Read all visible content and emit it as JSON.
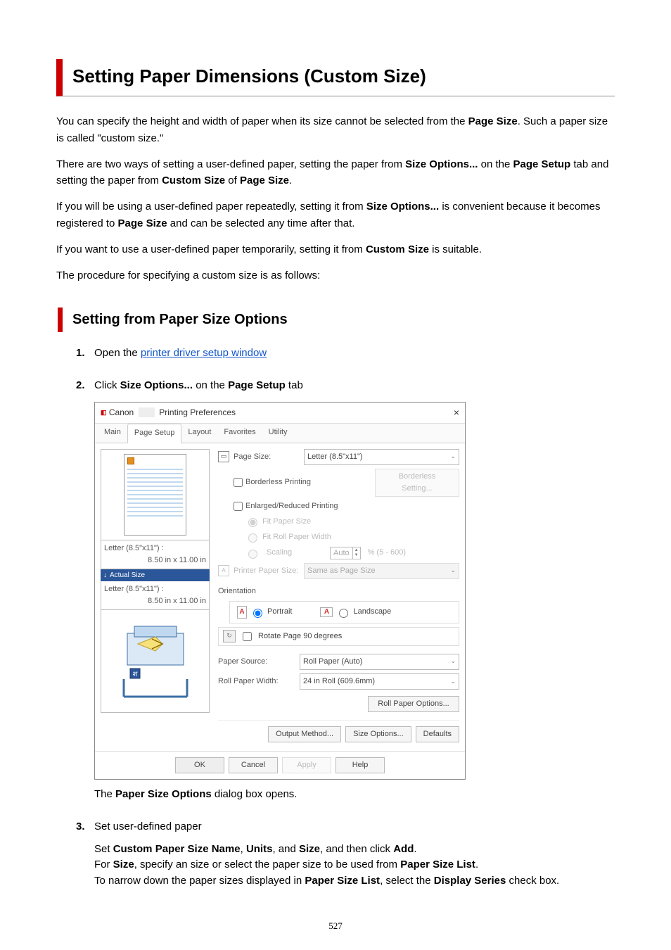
{
  "page": {
    "title": "Setting Paper Dimensions (Custom Size)",
    "intro1_a": "You can specify the height and width of paper when its size cannot be selected from the ",
    "intro1_b": "Page Size",
    "intro1_c": ". Such a paper size is called \"custom size.\"",
    "intro2_a": "There are two ways of setting a user-defined paper, setting the paper from ",
    "intro2_b": "Size Options...",
    "intro2_c": " on the ",
    "intro2_d": "Page Setup",
    "intro2_e": " tab and setting the paper from ",
    "intro2_f": "Custom Size",
    "intro2_g": " of ",
    "intro2_h": "Page Size",
    "intro2_i": ".",
    "intro3_a": "If you will be using a user-defined paper repeatedly, setting it from ",
    "intro3_b": "Size Options...",
    "intro3_c": " is convenient because it becomes registered to ",
    "intro3_d": "Page Size",
    "intro3_e": " and can be selected any time after that.",
    "intro4_a": "If you want to use a user-defined paper temporarily, setting it from ",
    "intro4_b": "Custom Size",
    "intro4_c": " is suitable.",
    "intro5": "The procedure for specifying a custom size is as follows:",
    "h2": "Setting from Paper Size Options",
    "page_number": "527"
  },
  "steps": {
    "s1_num": "1.",
    "s1_a": "Open the ",
    "s1_link": "printer driver setup window",
    "s2_num": "2.",
    "s2_a": "Click ",
    "s2_b": "Size Options...",
    "s2_c": " on the ",
    "s2_d": "Page Setup",
    "s2_e": " tab",
    "s2_body_a": "The ",
    "s2_body_b": "Paper Size Options",
    "s2_body_c": " dialog box opens.",
    "s3_num": "3.",
    "s3_title": "Set user-defined paper",
    "s3_l1_a": "Set ",
    "s3_l1_b": "Custom Paper Size Name",
    "s3_l1_c": ", ",
    "s3_l1_d": "Units",
    "s3_l1_e": ", and ",
    "s3_l1_f": "Size",
    "s3_l1_g": ", and then click ",
    "s3_l1_h": "Add",
    "s3_l1_i": ".",
    "s3_l2_a": "For ",
    "s3_l2_b": "Size",
    "s3_l2_c": ", specify an size or select the paper size to be used from ",
    "s3_l2_d": "Paper Size List",
    "s3_l2_e": ".",
    "s3_l3_a": "To narrow down the paper sizes displayed in ",
    "s3_l3_b": "Paper Size List",
    "s3_l3_c": ", select the ",
    "s3_l3_d": "Display Series",
    "s3_l3_e": " check box."
  },
  "dialog": {
    "title_a": "Canon",
    "title_b": "Printing Preferences",
    "close": "×",
    "tabs": [
      "Main",
      "Page Setup",
      "Layout",
      "Favorites",
      "Utility"
    ],
    "active_tab_index": 1,
    "preview_label_a": "Letter (8.5\"x11\") :",
    "preview_label_b": "8.50 in x 11.00 in",
    "actual_size": "Actual Size",
    "preview2_label_a": "Letter (8.5\"x11\") :",
    "preview2_label_b": "8.50 in x 11.00 in",
    "page_size_label": "Page Size:",
    "page_size_value": "Letter (8.5\"x11\")",
    "borderless_label": "Borderless Printing",
    "borderless_btn": "Borderless Setting...",
    "enlarged_label": "Enlarged/Reduced Printing",
    "fit_paper": "Fit Paper Size",
    "fit_roll": "Fit Roll Paper Width",
    "scaling": "Scaling",
    "scaling_val": "Auto",
    "scaling_range": "% (5 - 600)",
    "printer_paper_label": "Printer Paper Size:",
    "printer_paper_value": "Same as Page Size",
    "orientation_label": "Orientation",
    "portrait": "Portrait",
    "landscape": "Landscape",
    "rotate_label": "Rotate Page 90 degrees",
    "paper_source_label": "Paper Source:",
    "paper_source_value": "Roll Paper (Auto)",
    "roll_width_label": "Roll Paper Width:",
    "roll_width_value": "24 in Roll (609.6mm)",
    "roll_options_btn": "Roll Paper Options...",
    "output_method_btn": "Output Method...",
    "size_options_btn": "Size Options...",
    "defaults_btn": "Defaults",
    "ok": "OK",
    "cancel": "Cancel",
    "apply": "Apply",
    "help": "Help"
  }
}
